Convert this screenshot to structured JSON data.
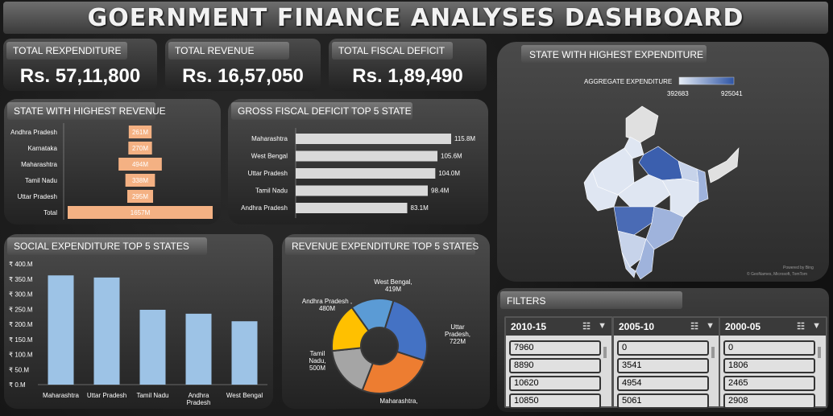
{
  "title": "GOERNMENT FINANCE ANALYSES DASHBOARD",
  "kpis": {
    "expenditure": {
      "label": "TOTAL REXPENDITURE",
      "value": "Rs. 57,11,800"
    },
    "revenue": {
      "label": "TOTAL REVENUE",
      "value": "Rs. 16,57,050"
    },
    "deficit": {
      "label": "TOTAL FISCAL DEFICIT",
      "value": "Rs. 1,89,490"
    }
  },
  "revenue_chart_title": "STATE WITH HIGHEST REVENUE",
  "deficit_chart_title": "GROSS FISCAL DEFICIT TOP 5 STATE",
  "social_chart_title": "SOCIAL EXPENDITURE TOP 5 STATES",
  "revexp_chart_title": "REVENUE EXPENDITURE TOP 5 STATES",
  "map": {
    "title": "STATE WITH HIGHEST EXPENDITURE",
    "legend_label": "AGGREGATE EXPENDITURE",
    "legend_min": "392683",
    "legend_max": "925041",
    "attribution_1": "Powered by Bing",
    "attribution_2": "© GeoNames, Microsoft, TomTom",
    "colors": {
      "low": "#dfe6f2",
      "mid": "#9fb3dc",
      "high": "#3b5fae"
    }
  },
  "filters": {
    "title": "FILTERS",
    "slicers": [
      {
        "header": "2010-15",
        "items": [
          "7960",
          "8890",
          "10620",
          "10850"
        ]
      },
      {
        "header": "2005-10",
        "items": [
          "0",
          "3541",
          "4954",
          "5061"
        ]
      },
      {
        "header": "2000-05",
        "items": [
          "0",
          "1806",
          "2465",
          "2908"
        ]
      }
    ]
  },
  "chart_data": [
    {
      "type": "bar",
      "orientation": "horizontal",
      "title": "STATE WITH HIGHEST REVENUE",
      "categories": [
        "Andhra Pradesh",
        "Karnataka",
        "Maharashtra",
        "Tamil Nadu",
        "Uttar Pradesh",
        "Total"
      ],
      "values": [
        261,
        270,
        494,
        338,
        295,
        1657
      ],
      "labels": [
        "261M",
        "270M",
        "494M",
        "338M",
        "295M",
        "1657M"
      ],
      "color": "#f4b183"
    },
    {
      "type": "bar",
      "orientation": "horizontal",
      "title": "GROSS FISCAL DEFICIT TOP 5 STATE",
      "categories": [
        "Maharashtra",
        "West Bengal",
        "Uttar Pradesh",
        "Tamil Nadu",
        "Andhra Pradesh"
      ],
      "values": [
        115.8,
        105.6,
        104.0,
        98.4,
        83.1
      ],
      "labels": [
        "115.8M",
        "105.6M",
        "104.0M",
        "98.4M",
        "83.1M"
      ],
      "color": "#d9d9d9"
    },
    {
      "type": "bar",
      "title": "SOCIAL EXPENDITURE TOP 5 STATES",
      "categories": [
        "Maharashtra",
        "Uttar Pradesh",
        "Tamil Nadu",
        "Andhra Pradesh",
        "West Bengal"
      ],
      "values": [
        362,
        355,
        248,
        235,
        210
      ],
      "yticks": [
        "₹ 0.M",
        "₹ 50.M",
        "₹ 100.M",
        "₹ 150.M",
        "₹ 200.M",
        "₹ 250.M",
        "₹ 300.M",
        "₹ 350.M",
        "₹ 400.M"
      ],
      "ylim": [
        0,
        400
      ],
      "color": "#9dc3e6"
    },
    {
      "type": "pie",
      "title": "REVENUE EXPENDITURE TOP 5 STATES",
      "slices": [
        {
          "label": "Uttar Pradesh, 722M",
          "value": 722,
          "color": "#4472c4"
        },
        {
          "label": "Maharashtra,",
          "value": 740,
          "color": "#ed7d31"
        },
        {
          "label": "Tamil Nadu, 500M",
          "value": 500,
          "color": "#a5a5a5"
        },
        {
          "label": "Andhra Pradesh , 480M",
          "value": 480,
          "color": "#ffc000"
        },
        {
          "label": "West Bengal, 419M",
          "value": 419,
          "color": "#5b9bd5"
        }
      ]
    }
  ]
}
